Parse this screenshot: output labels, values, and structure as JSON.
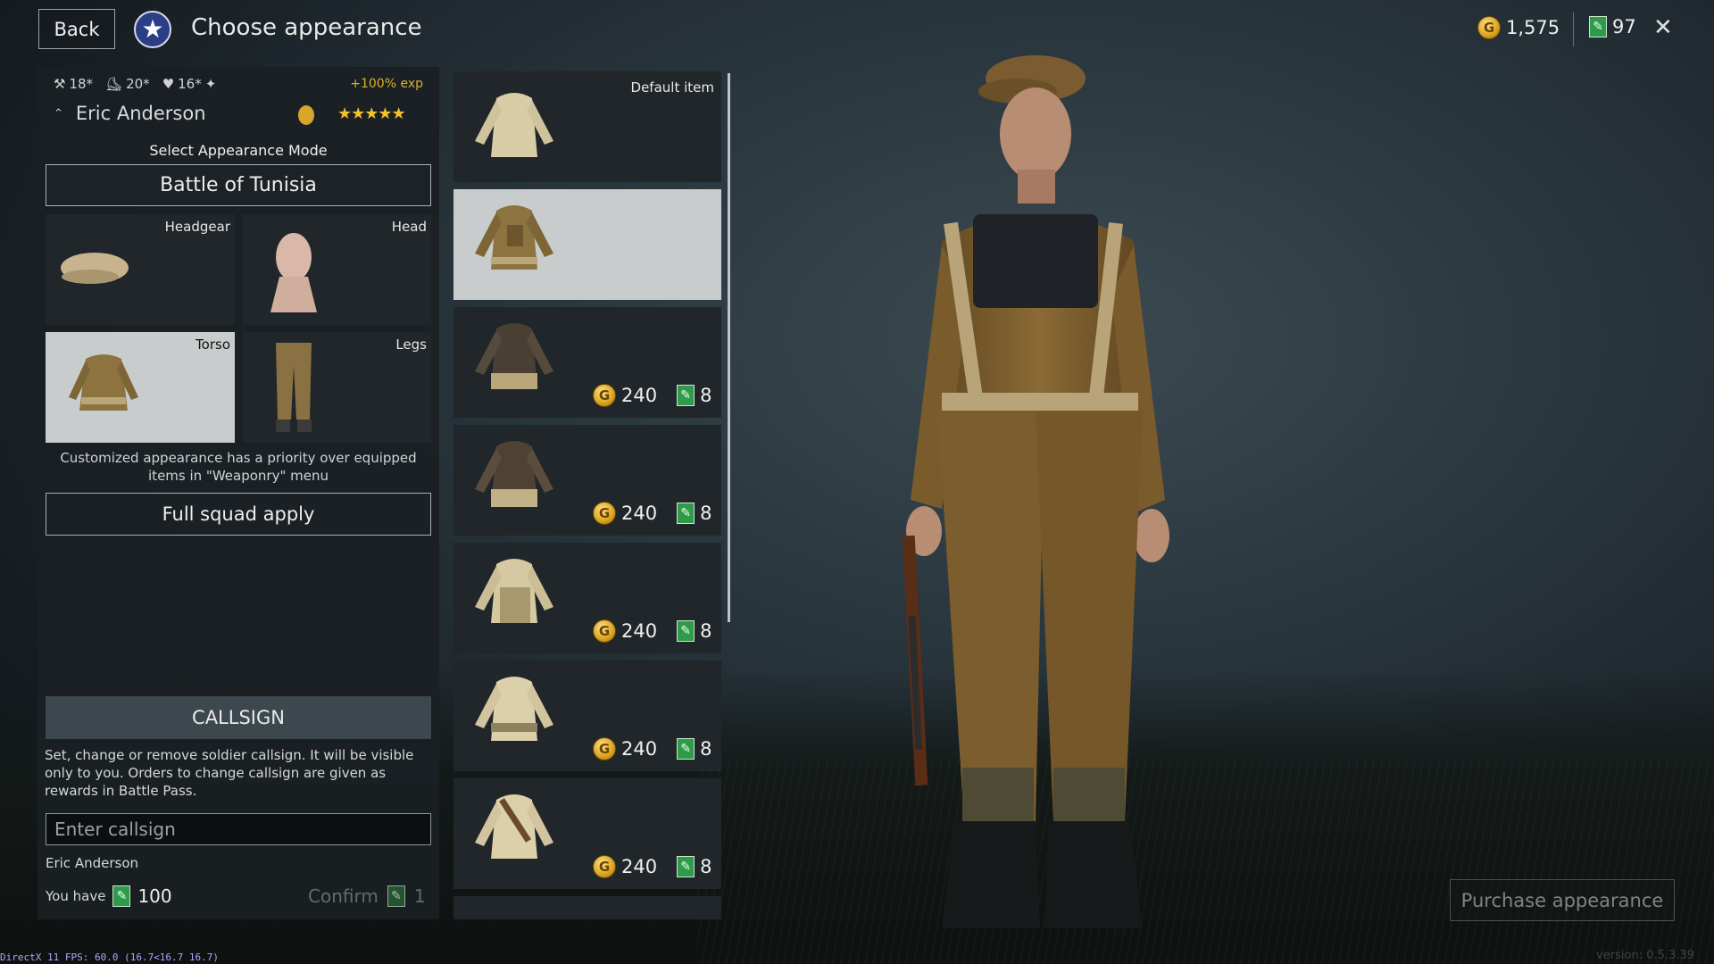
{
  "header": {
    "back_label": "Back",
    "title": "Choose appearance",
    "silver_amount": "1,575",
    "tickets_amount": "97",
    "close_icon": "close-icon"
  },
  "soldier": {
    "stat_1": "18*",
    "stat_2": "20*",
    "stat_3": "16*",
    "exp_bonus": "+100% exp",
    "name": "Eric Anderson",
    "stars": "★★★★★"
  },
  "appearance": {
    "mode_label": "Select Appearance Mode",
    "mode_value": "Battle of Tunisia",
    "slots": [
      {
        "label": "Headgear"
      },
      {
        "label": "Head"
      },
      {
        "label": "Torso"
      },
      {
        "label": "Legs"
      }
    ],
    "selected_slot": "Torso",
    "notice": "Customized appearance has a priority over equipped items in \"Weaponry\" menu",
    "squad_apply_label": "Full squad apply"
  },
  "items": [
    {
      "default_label": "Default item"
    },
    {
      "selected": true
    },
    {
      "price_silver": "240",
      "price_tickets": "8"
    },
    {
      "price_silver": "240",
      "price_tickets": "8"
    },
    {
      "price_silver": "240",
      "price_tickets": "8"
    },
    {
      "price_silver": "240",
      "price_tickets": "8"
    },
    {
      "price_silver": "240",
      "price_tickets": "8"
    }
  ],
  "callsign": {
    "heading": "CALLSIGN",
    "description": "Set, change or remove soldier callsign. It will be visible only to you. Orders to change callsign are given as rewards in Battle Pass.",
    "placeholder": "Enter callsign",
    "current_name": "Eric Anderson",
    "you_have_label": "You have",
    "you_have_amount": "100",
    "confirm_label": "Confirm",
    "confirm_cost": "1"
  },
  "purchase_label": "Purchase appearance",
  "debug": {
    "fps_text": "DirectX 11 FPS: 60.0 (16.7<16.7 16.7)",
    "version": "version: 0.5.3.39"
  },
  "colors": {
    "panel": "#1a1f23",
    "selected_tile": "#c9cccd",
    "gold": "#d9a21c",
    "ticket_green": "#2f9b4a",
    "exp_yellow": "#d8b42a"
  }
}
